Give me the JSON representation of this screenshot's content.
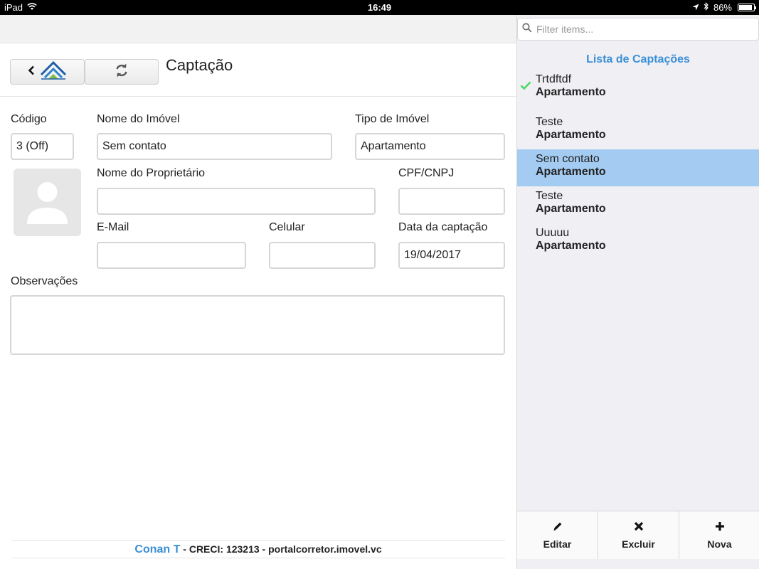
{
  "status_bar": {
    "device": "iPad",
    "time": "16:49",
    "battery": "86%"
  },
  "header": {
    "title": "Captação"
  },
  "form": {
    "codigo_label": "Código",
    "codigo_value": "3 (Off)",
    "nome_imovel_label": "Nome do Imóvel",
    "nome_imovel_value": "Sem contato",
    "tipo_imovel_label": "Tipo de Imóvel",
    "tipo_imovel_value": "Apartamento",
    "proprietario_label": "Nome do Proprietário",
    "proprietario_value": "",
    "cpf_label": "CPF/CNPJ",
    "cpf_value": "",
    "email_label": "E-Mail",
    "email_value": "",
    "celular_label": "Celular",
    "celular_value": "",
    "data_label": "Data da captação",
    "data_value": "19/04/2017",
    "obs_label": "Observações",
    "obs_value": ""
  },
  "footer": {
    "name": "Conan T",
    "rest": " - CRECI: 123213 - portalcorretor.imovel.vc"
  },
  "sidebar": {
    "filter_placeholder": "Filter items...",
    "list_title": "Lista de Captações",
    "items": [
      {
        "title": "Trtdftdf",
        "subtitle": "Apartamento",
        "checked": true
      },
      {
        "title": "Teste",
        "subtitle": "Apartamento"
      },
      {
        "title": "Sem contato",
        "subtitle": "Apartamento",
        "selected": true
      },
      {
        "title": "Teste",
        "subtitle": "Apartamento"
      },
      {
        "title": "Uuuuu",
        "subtitle": "Apartamento"
      }
    ],
    "actions": {
      "edit": "Editar",
      "delete": "Excluir",
      "new": "Nova"
    }
  },
  "colors": {
    "accent": "#3a8fd6",
    "selected": "#a4ccf2",
    "check": "#4cd964"
  }
}
